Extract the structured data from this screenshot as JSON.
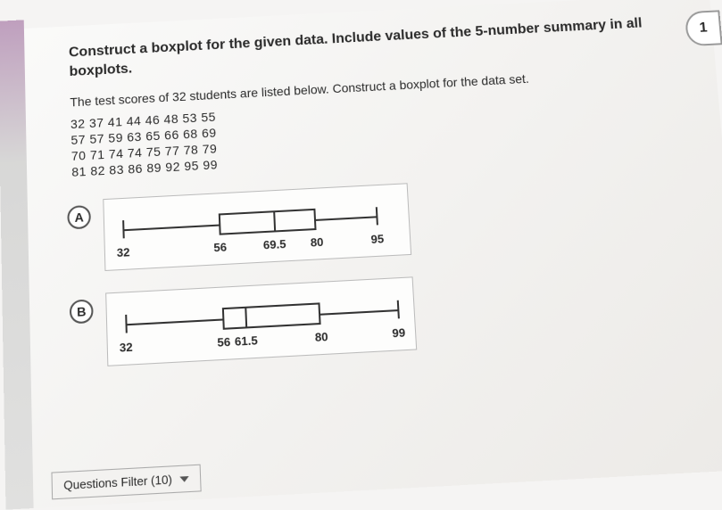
{
  "question_number": "1",
  "prompt": "Construct a boxplot for the given data. Include values of the 5-number summary in all boxplots.",
  "subprompt": "The test scores of 32 students are listed below. Construct a boxplot for the data set.",
  "data_rows": [
    "32 37 41 44 46 48 53 55",
    "57 57 59 63 65 66 68 69",
    "70 71 74 74 75 77 78 79",
    "81 82 83 86 89 92 95 99"
  ],
  "choices": [
    {
      "letter": "A",
      "summary": {
        "min": "32",
        "q1": "56",
        "median": "69.5",
        "q3": "80",
        "max": "95"
      }
    },
    {
      "letter": "B",
      "summary": {
        "min": "32",
        "q1": "56",
        "median": "61.5",
        "q3": "80",
        "max": "99"
      }
    }
  ],
  "filter_label": "Questions Filter (10)",
  "chart_data": [
    {
      "type": "boxplot",
      "label": "A",
      "min": 32,
      "q1": 56,
      "median": 69.5,
      "q3": 80,
      "max": 95,
      "axis_range": [
        32,
        99
      ]
    },
    {
      "type": "boxplot",
      "label": "B",
      "min": 32,
      "q1": 56,
      "median": 61.5,
      "q3": 80,
      "max": 99,
      "axis_range": [
        32,
        99
      ]
    }
  ]
}
